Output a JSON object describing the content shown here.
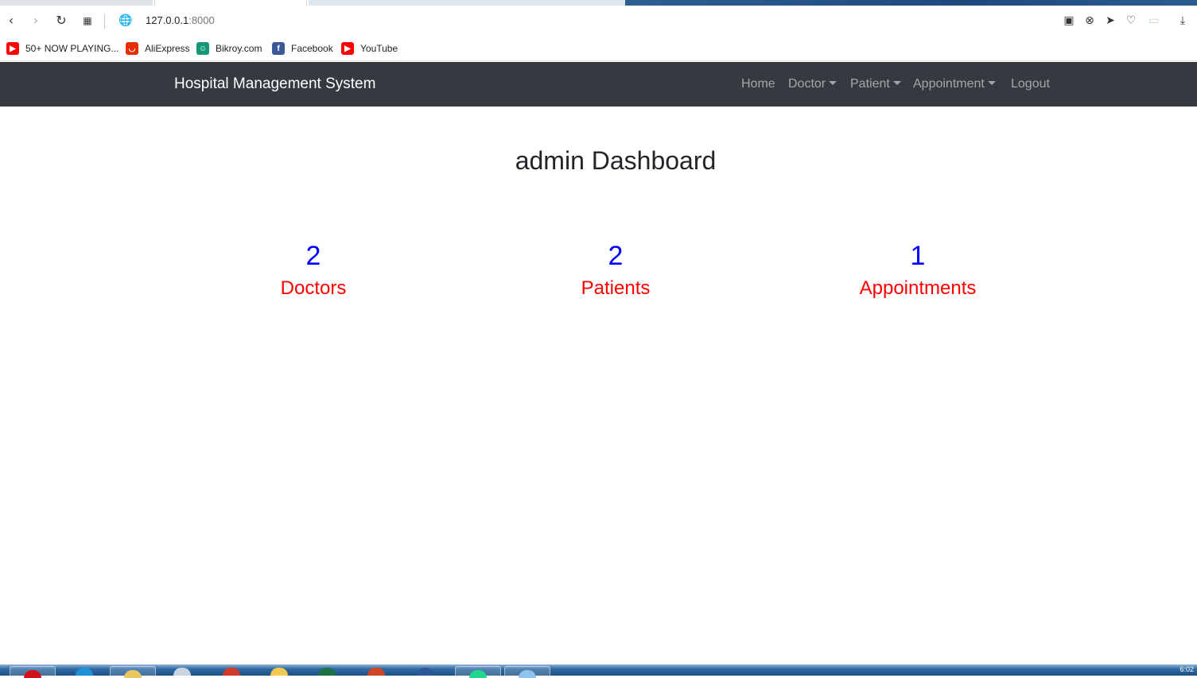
{
  "browser": {
    "url_host": "127.0.0.1",
    "url_port": ":8000",
    "bookmarks": [
      {
        "label": "50+ NOW PLAYING...",
        "icon": "youtube-icon",
        "color": "#ff0000"
      },
      {
        "label": "AliExpress",
        "icon": "aliexpress-icon",
        "color": "#e62e04"
      },
      {
        "label": "Bikroy.com",
        "icon": "bikroy-icon",
        "color": "#149777"
      },
      {
        "label": "Facebook",
        "icon": "facebook-icon",
        "color": "#3b5998"
      },
      {
        "label": "YouTube",
        "icon": "youtube-icon",
        "color": "#ff0000"
      }
    ]
  },
  "navbar": {
    "brand": "Hospital Management System",
    "links": {
      "home": "Home",
      "doctor": "Doctor",
      "patient": "Patient",
      "appointment": "Appointment",
      "logout": "Logout"
    },
    "background": "#343a40"
  },
  "dashboard": {
    "title": "admin Dashboard",
    "stats": [
      {
        "count": "2",
        "label": "Doctors"
      },
      {
        "count": "2",
        "label": "Patients"
      },
      {
        "count": "1",
        "label": "Appointments"
      }
    ],
    "count_color": "#0000ff",
    "label_color": "#ff0000"
  },
  "taskbar": {
    "clock": "6:02"
  }
}
